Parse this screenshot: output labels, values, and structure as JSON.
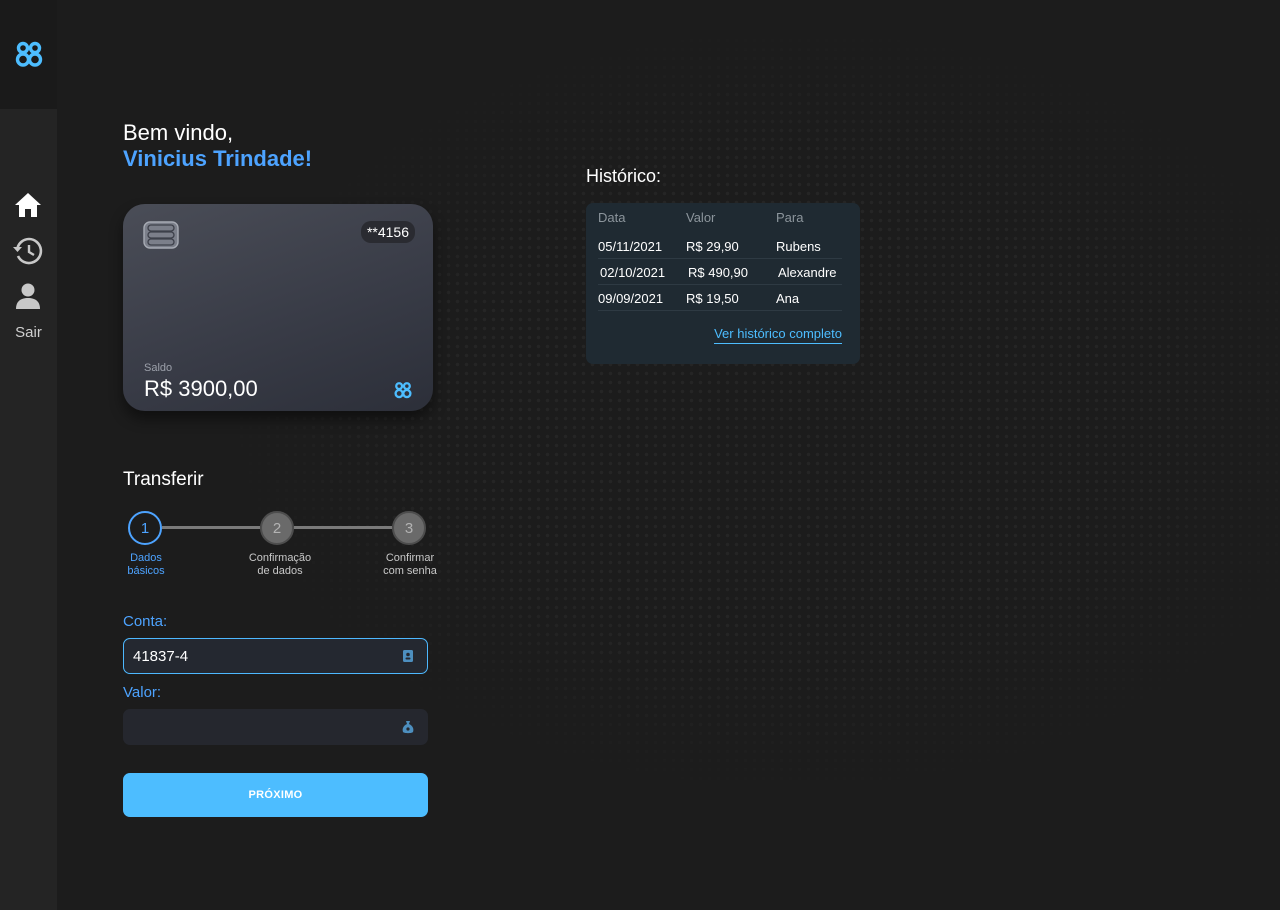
{
  "sidebar": {
    "logo": "logo-88-icon",
    "items": [
      {
        "name": "home",
        "icon": "home-icon"
      },
      {
        "name": "history",
        "icon": "history-icon"
      },
      {
        "name": "profile",
        "icon": "user-icon"
      }
    ],
    "logout_label": "Sair"
  },
  "welcome": {
    "greeting": "Bem vindo,",
    "user_name": "Vinicius Trindade!"
  },
  "card": {
    "number": "**4156",
    "balance_label": "Saldo",
    "balance_value": "R$ 3900,00"
  },
  "transfer": {
    "title": "Transferir",
    "steps": [
      {
        "number": "1",
        "label_line1": "Dados",
        "label_line2": "básicos",
        "active": true
      },
      {
        "number": "2",
        "label_line1": "Confirmação",
        "label_line2": "de dados",
        "active": false
      },
      {
        "number": "3",
        "label_line1": "Confirmar",
        "label_line2": "com senha",
        "active": false
      }
    ],
    "account_label": "Conta:",
    "account_value": "41837-4",
    "amount_label": "Valor:",
    "amount_value": "",
    "next_label": "PRÓXIMO"
  },
  "history": {
    "title": "Histórico:",
    "columns": [
      "Data",
      "Valor",
      "Para"
    ],
    "rows": [
      {
        "date": "05/11/2021",
        "value": "R$ 29,90",
        "to": "Rubens"
      },
      {
        "date": "02/10/2021",
        "value": "R$ 490,90",
        "to": "Alexandre"
      },
      {
        "date": "09/09/2021",
        "value": "R$ 19,50",
        "to": "Ana"
      }
    ],
    "link_label": "Ver histórico completo"
  },
  "colors": {
    "accent": "#4da3ff",
    "button": "#4dbdff",
    "background": "#1c1c1c"
  }
}
